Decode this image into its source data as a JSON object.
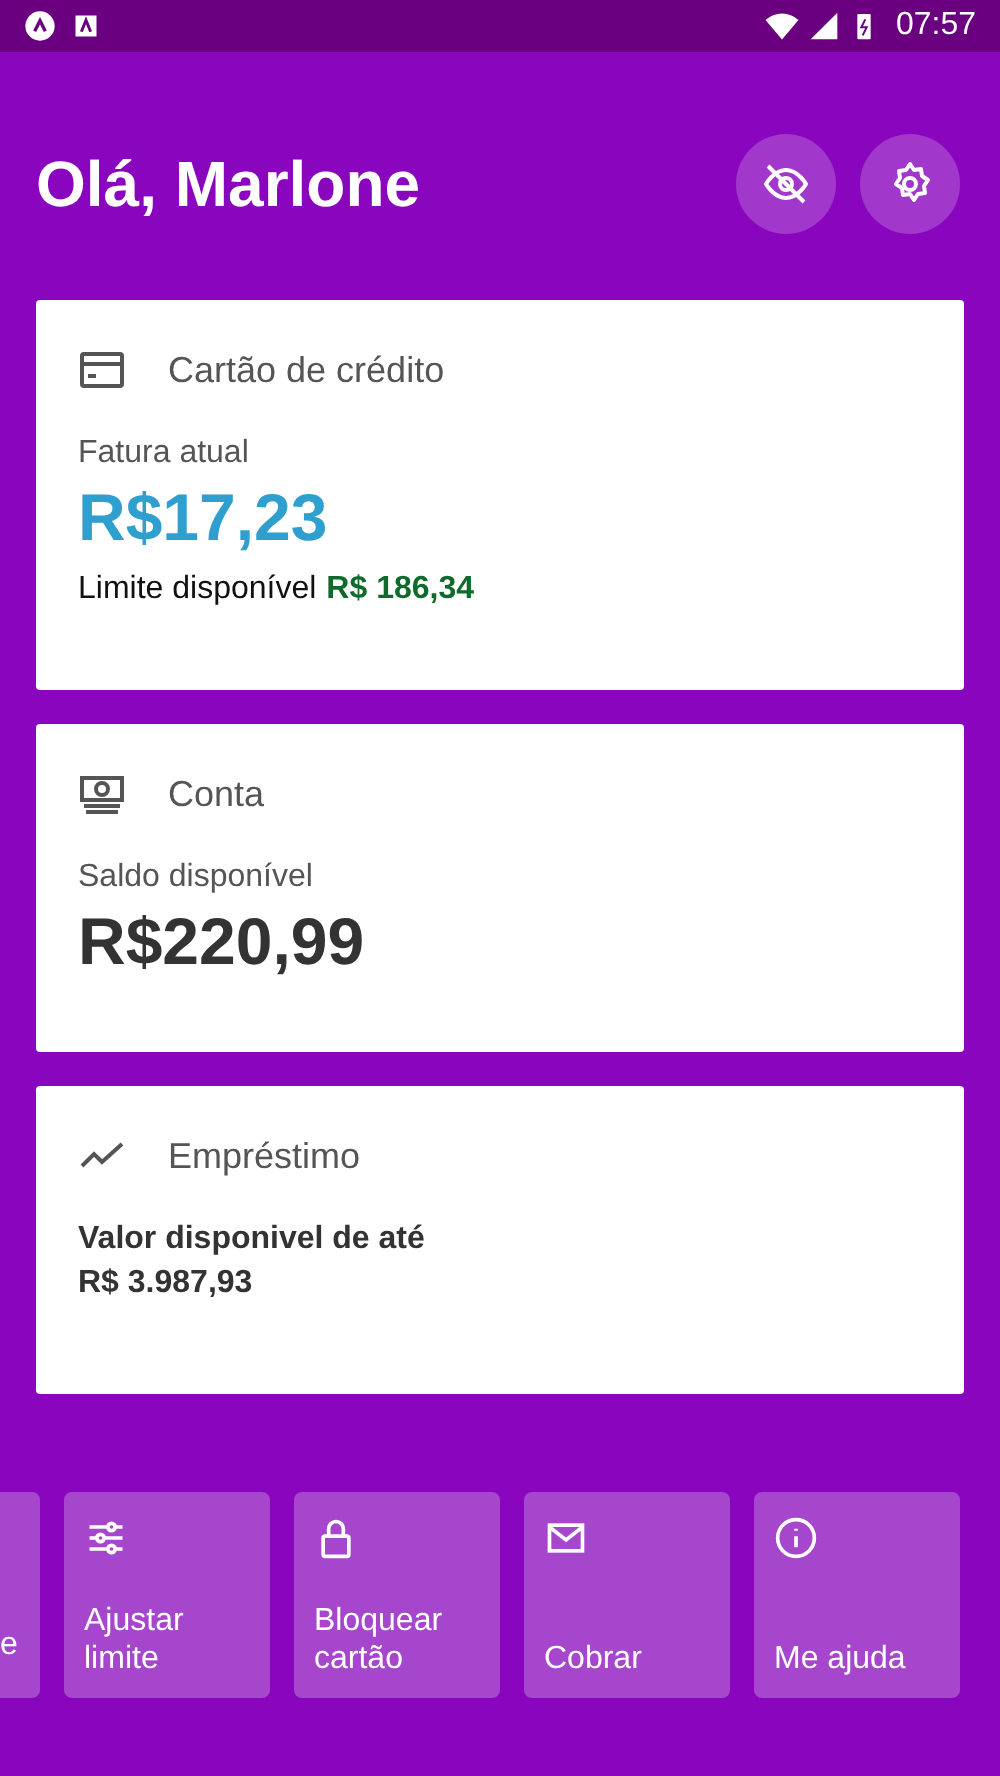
{
  "status_bar": {
    "time": "07:57"
  },
  "header": {
    "greeting": "Olá, Marlone"
  },
  "cards": [
    {
      "kind": "credit",
      "title": "Cartão de crédito",
      "label": "Fatura atual",
      "amount": "R$17,23",
      "limit_label": "Limite disponível",
      "limit_value": "R$ 186,34"
    },
    {
      "kind": "account",
      "title": "Conta",
      "label": "Saldo disponível",
      "amount": "R$220,99"
    },
    {
      "kind": "loan",
      "title": "Empréstimo",
      "label": "Valor disponivel de até",
      "amount": "R$ 3.987,93"
    }
  ],
  "actions": [
    {
      "kind": "partial",
      "label": "e"
    },
    {
      "kind": "sliders",
      "label": "Ajustar limite"
    },
    {
      "kind": "lock",
      "label": "Bloquear cartão"
    },
    {
      "kind": "mail",
      "label": "Cobrar"
    },
    {
      "kind": "info",
      "label": "Me ajuda"
    }
  ]
}
